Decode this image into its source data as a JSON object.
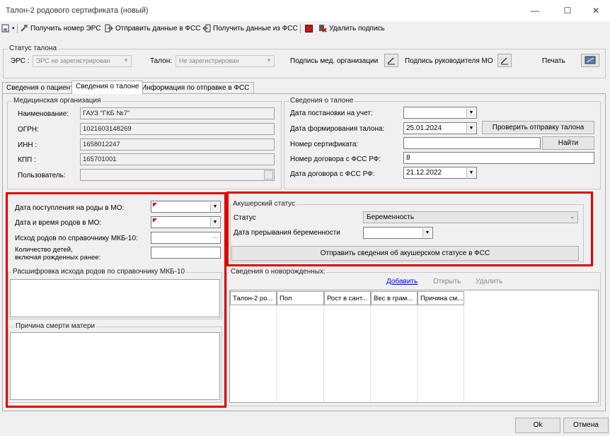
{
  "window": {
    "title": "Талон-2 родового сертификата (новый)",
    "minimize_glyph": "—",
    "maximize_glyph": "☐",
    "close_glyph": "✕"
  },
  "toolbar": {
    "get_ers": "Получить номер ЭРС",
    "send_fss": "Отправить данные в ФСС",
    "receive_fss": "Получить данные из ФСС",
    "delete_sign": "Удалить подпись"
  },
  "status": {
    "group_label": "Статус талона",
    "ers_label": "ЭРС :",
    "ers_value": "ЭРС не зарегистрирован",
    "talon_label": "Талон:",
    "talon_value": "Не зарегистрирован",
    "sign_med_org": "Подпись мед. организации",
    "sign_head": "Подпись руководителя МО",
    "print": "Печать"
  },
  "tabs": [
    {
      "label": "Сведения о пациенте"
    },
    {
      "label": "Сведения о талоне"
    },
    {
      "label": "Информация по отправке в ФСС"
    }
  ],
  "med_org": {
    "group_label": "Медицинская организация",
    "name_label": "Наименование:",
    "name_value": "ГАУЗ \"ГКБ №7\"",
    "ogrn_label": "ОГРН:",
    "ogrn_value": "1021603148269",
    "inn_label": "ИНН :",
    "inn_value": "1658012247",
    "kpp_label": "КПП :",
    "kpp_value": "165701001",
    "user_label": "Пользователь:",
    "user_value": ""
  },
  "talon_info": {
    "group_label": "Сведения о талоне",
    "reg_date_label": "Дата постановки на учет:",
    "reg_date_value": "",
    "form_date_label": "Дата формирования талона:",
    "form_date_value": "25.01.2024",
    "check_btn": "Проверить отправку талона",
    "cert_label": "Номер сертификата:",
    "cert_value": "",
    "find_btn": "Найти",
    "contract_num_label": "Номер договора с ФСС РФ:",
    "contract_num_value": "8",
    "contract_date_label": "Дата договора с ФСС РФ:",
    "contract_date_value": "21.12.2022"
  },
  "birth": {
    "admission_label": "Дата поступления на роды в МО:",
    "birth_datetime_label": "Дата и время родов в МО:",
    "outcome_label": "Исход родов по справочнику МКБ-10:",
    "children_label_1": "Количество  детей,",
    "children_label_2": "включая рожденных ранее:",
    "outcome_decode_label": "Расшифровка исхода родов по справочнику МКБ-10",
    "mother_death_label": "Причина смерти матери"
  },
  "obstetric": {
    "group_label": "Акушерский статус",
    "status_label": "Статус",
    "status_value": "Беременность",
    "termination_label": "Дата прерывания беременности",
    "send_btn": "Отправить сведения  об акушерском статусе в ФСС"
  },
  "newborns": {
    "group_label": "Сведения о новорожденных:",
    "add": "Добавить",
    "open": "Открыть",
    "delete": "Удалить",
    "columns": [
      "Талон-2 ро...",
      "Пол",
      "Рост в сант...",
      "Вес в грам...",
      "Причина см..."
    ]
  },
  "footer": {
    "ok": "Ok",
    "cancel": "Отмена"
  },
  "colors": {
    "highlight": "#e00000",
    "link": "#0000ee"
  }
}
